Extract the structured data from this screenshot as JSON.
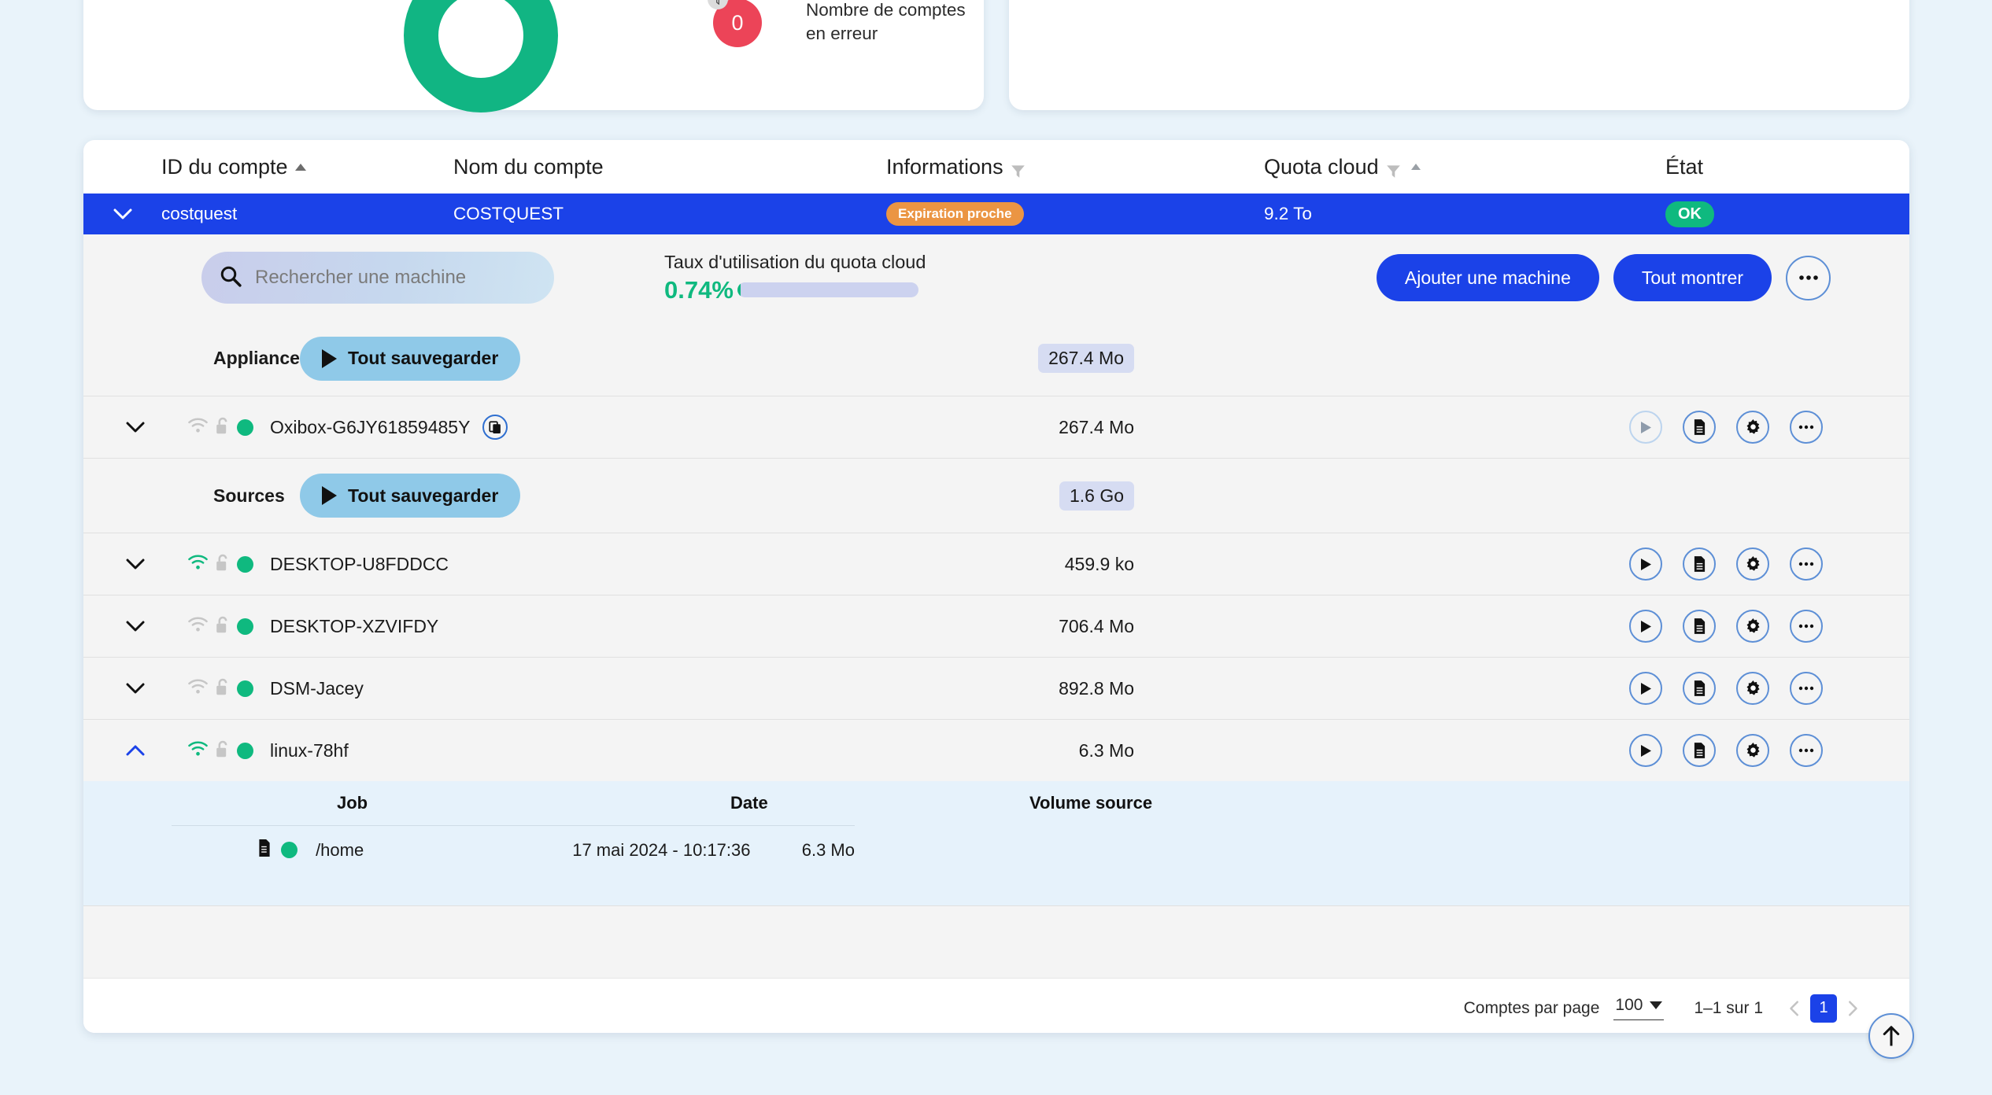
{
  "summary": {
    "error_count": "0",
    "error_label_line1": "Nombre de comptes",
    "error_label_line2": "en erreur"
  },
  "table": {
    "headers": {
      "account_id": "ID du compte",
      "account_name": "Nom du compte",
      "informations": "Informations",
      "cloud_quota": "Quota cloud",
      "state": "État"
    },
    "account": {
      "id": "costquest",
      "name": "COSTQUEST",
      "info_badge": "Expiration proche",
      "quota": "9.2 To",
      "state_badge": "OK"
    }
  },
  "toolbar": {
    "search_placeholder": "Rechercher une machine",
    "search_value": "",
    "quota_usage_label": "Taux d'utilisation du quota cloud",
    "quota_usage_percent": "0.74%",
    "quota_usage_value": 0.74,
    "add_machine_label": "Ajouter une machine",
    "show_all_label": "Tout montrer"
  },
  "groups": [
    {
      "label": "Appliances",
      "backup_all_label": "Tout sauvegarder",
      "total_size": "267.4 Mo",
      "rows": [
        {
          "name": "Oxibox-G6JY61859485Y",
          "size": "267.4 Mo",
          "wifi_state": "offline",
          "lock_state": "unlocked",
          "status": "online",
          "expanded": false,
          "has_copy_icon": true,
          "play_disabled": true
        }
      ]
    },
    {
      "label": "Sources",
      "backup_all_label": "Tout sauvegarder",
      "total_size": "1.6 Go",
      "rows": [
        {
          "name": "DESKTOP-U8FDDCC",
          "size": "459.9 ko",
          "wifi_state": "online",
          "lock_state": "unlocked",
          "status": "online",
          "expanded": false,
          "has_copy_icon": false,
          "play_disabled": false
        },
        {
          "name": "DESKTOP-XZVIFDY",
          "size": "706.4 Mo",
          "wifi_state": "offline",
          "lock_state": "unlocked",
          "status": "online",
          "expanded": false,
          "has_copy_icon": false,
          "play_disabled": false
        },
        {
          "name": "DSM-Jacey",
          "size": "892.8 Mo",
          "wifi_state": "offline",
          "lock_state": "unlocked",
          "status": "online",
          "expanded": false,
          "has_copy_icon": false,
          "play_disabled": false
        },
        {
          "name": "linux-78hf",
          "size": "6.3 Mo",
          "wifi_state": "online",
          "lock_state": "unlocked",
          "status": "online",
          "expanded": true,
          "has_copy_icon": false,
          "play_disabled": false
        }
      ]
    }
  ],
  "jobs_panel": {
    "headers": {
      "job": "Job",
      "date": "Date",
      "volume": "Volume source"
    },
    "rows": [
      {
        "name": "/home",
        "date": "17 mai 2024 - 10:17:36",
        "volume": "6.3 Mo",
        "status": "online"
      }
    ]
  },
  "footer": {
    "per_page_label": "Comptes par page",
    "per_page_value": "100",
    "range_label": "1–1 sur 1",
    "current_page": "1"
  },
  "colors": {
    "accent_blue": "#1b42e8",
    "green": "#0fb97f",
    "orange": "#eb9543",
    "red": "#ec4458",
    "light_blue_btn": "#8fc9e8",
    "page_bg": "#e9f3fa"
  }
}
